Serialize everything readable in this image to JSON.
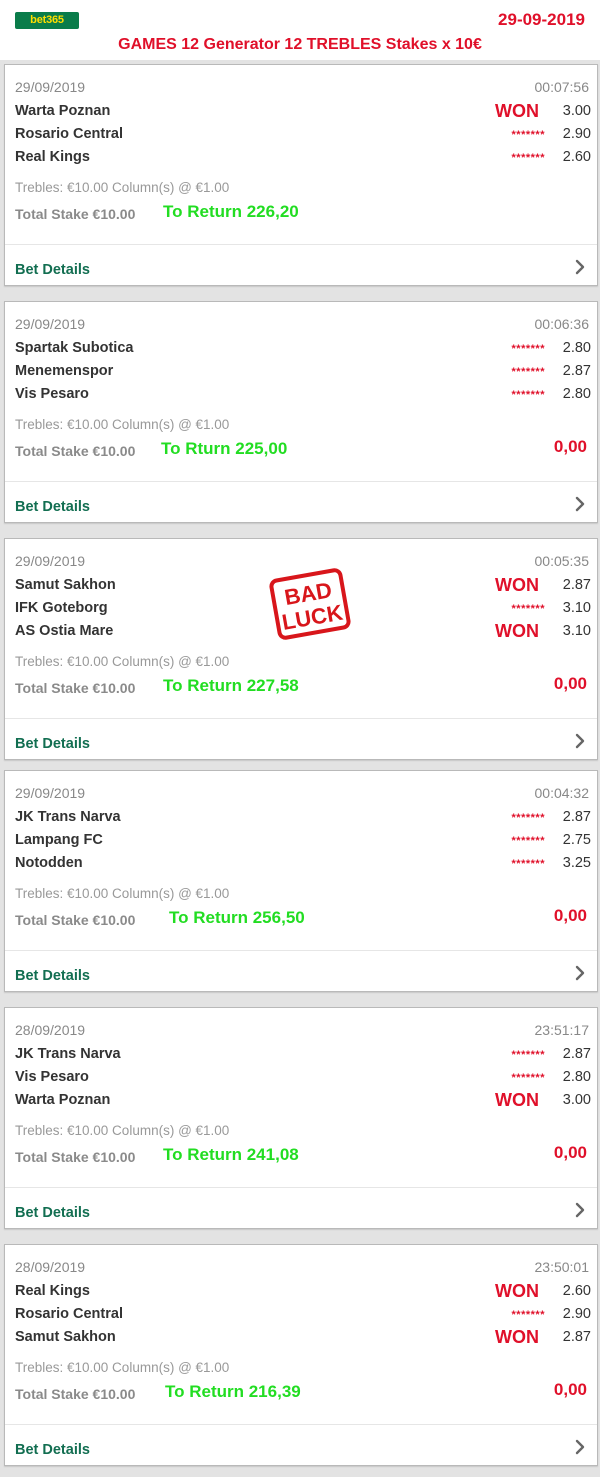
{
  "header": {
    "logo_text": "bet365",
    "date": "29-09-2019",
    "title": "GAMES 12 Generator 12 TREBLES Stakes x 10€"
  },
  "stamp": {
    "line1": "BAD",
    "line2": "LUCK"
  },
  "colors": {
    "won": "#e0102a",
    "return": "#22dd22",
    "details": "#126e51",
    "logo_bg": "#0a7c4a"
  },
  "bets": [
    {
      "date": "29/09/2019",
      "time": "00:07:56",
      "selections": [
        {
          "team": "Warta Poznan",
          "result": "WON",
          "odds": "3.00"
        },
        {
          "team": "Rosario Central",
          "result": "*******",
          "odds": "2.90"
        },
        {
          "team": "Real Kings",
          "result": "*******",
          "odds": "2.60"
        }
      ],
      "trebles": "Trebles: €10.00 Column(s) @ €1.00",
      "stake": "Total Stake €10.00",
      "to_return": "To Return 226,20",
      "final": "",
      "details": "Bet Details"
    },
    {
      "date": "29/09/2019",
      "time": "00:06:36",
      "selections": [
        {
          "team": "Spartak Subotica",
          "result": "*******",
          "odds": "2.80"
        },
        {
          "team": "Menemenspor",
          "result": "*******",
          "odds": "2.87"
        },
        {
          "team": "Vis Pesaro",
          "result": "*******",
          "odds": "2.80"
        }
      ],
      "trebles": "Trebles: €10.00 Column(s) @ €1.00",
      "stake": "Total Stake €10.00",
      "to_return": "To Rturn 225,00",
      "final": "0,00",
      "details": "Bet Details"
    },
    {
      "date": "29/09/2019",
      "time": "00:05:35",
      "selections": [
        {
          "team": "Samut Sakhon",
          "result": "WON",
          "odds": "2.87"
        },
        {
          "team": "IFK Goteborg",
          "result": "*******",
          "odds": "3.10"
        },
        {
          "team": "AS Ostia Mare",
          "result": "WON",
          "odds": "3.10"
        }
      ],
      "trebles": "Trebles: €10.00 Column(s) @ €1.00",
      "stake": "Total Stake €10.00",
      "to_return": "To Return 227,58",
      "final": "0,00",
      "details": "Bet Details"
    },
    {
      "date": "29/09/2019",
      "time": "00:04:32",
      "selections": [
        {
          "team": "JK Trans Narva",
          "result": "*******",
          "odds": "2.87"
        },
        {
          "team": "Lampang FC",
          "result": "*******",
          "odds": "2.75"
        },
        {
          "team": "Notodden",
          "result": "*******",
          "odds": "3.25"
        }
      ],
      "trebles": "Trebles: €10.00 Column(s) @ €1.00",
      "stake": "Total Stake €10.00",
      "to_return": "To Return 256,50",
      "final": "0,00",
      "details": "Bet Details"
    },
    {
      "date": "28/09/2019",
      "time": "23:51:17",
      "selections": [
        {
          "team": "JK Trans Narva",
          "result": "*******",
          "odds": "2.87"
        },
        {
          "team": "Vis Pesaro",
          "result": "*******",
          "odds": "2.80"
        },
        {
          "team": "Warta Poznan",
          "result": "WON",
          "odds": "3.00"
        }
      ],
      "trebles": "Trebles: €10.00 Column(s) @ €1.00",
      "stake": "Total Stake €10.00",
      "to_return": "To Return 241,08",
      "final": "0,00",
      "details": "Bet Details"
    },
    {
      "date": "28/09/2019",
      "time": "23:50:01",
      "selections": [
        {
          "team": "Real Kings",
          "result": "WON",
          "odds": "2.60"
        },
        {
          "team": "Rosario Central",
          "result": "*******",
          "odds": "2.90"
        },
        {
          "team": "Samut Sakhon",
          "result": "WON",
          "odds": "2.87"
        }
      ],
      "trebles": "Trebles: €10.00 Column(s) @ €1.00",
      "stake": "Total Stake €10.00",
      "to_return": "To Return 216,39",
      "final": "0,00",
      "details": "Bet Details"
    }
  ]
}
